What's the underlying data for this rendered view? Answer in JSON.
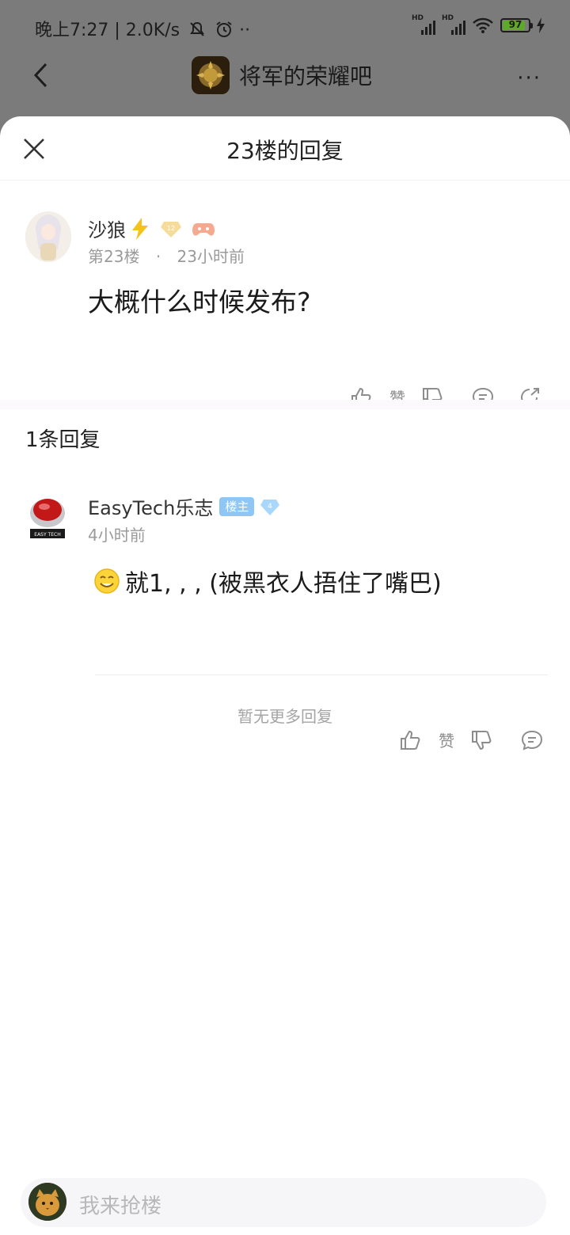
{
  "status": {
    "left": "晚上7:27 | 2.0K/s",
    "hd1": "HD",
    "hd2": "HD",
    "battery": "97"
  },
  "appbar": {
    "title": "将军的荣耀吧",
    "more": "···"
  },
  "sheet": {
    "title": "23楼的回复"
  },
  "post": {
    "username": "沙狼",
    "floor": "第23楼",
    "sep": "·",
    "time": "23小时前",
    "text": "大概什么时候发布?",
    "like_label": "赞"
  },
  "replies_count": "1条回复",
  "reply": {
    "username": "EasyTech乐志",
    "badge": "楼主",
    "level": "4",
    "time": "4小时前",
    "text": "就1, , , (被黑衣人捂住了嘴巴)",
    "like_label": "赞",
    "avatar_text": "EASY TECH"
  },
  "no_more": "暂无更多回复",
  "input": {
    "placeholder": "我来抢楼"
  }
}
